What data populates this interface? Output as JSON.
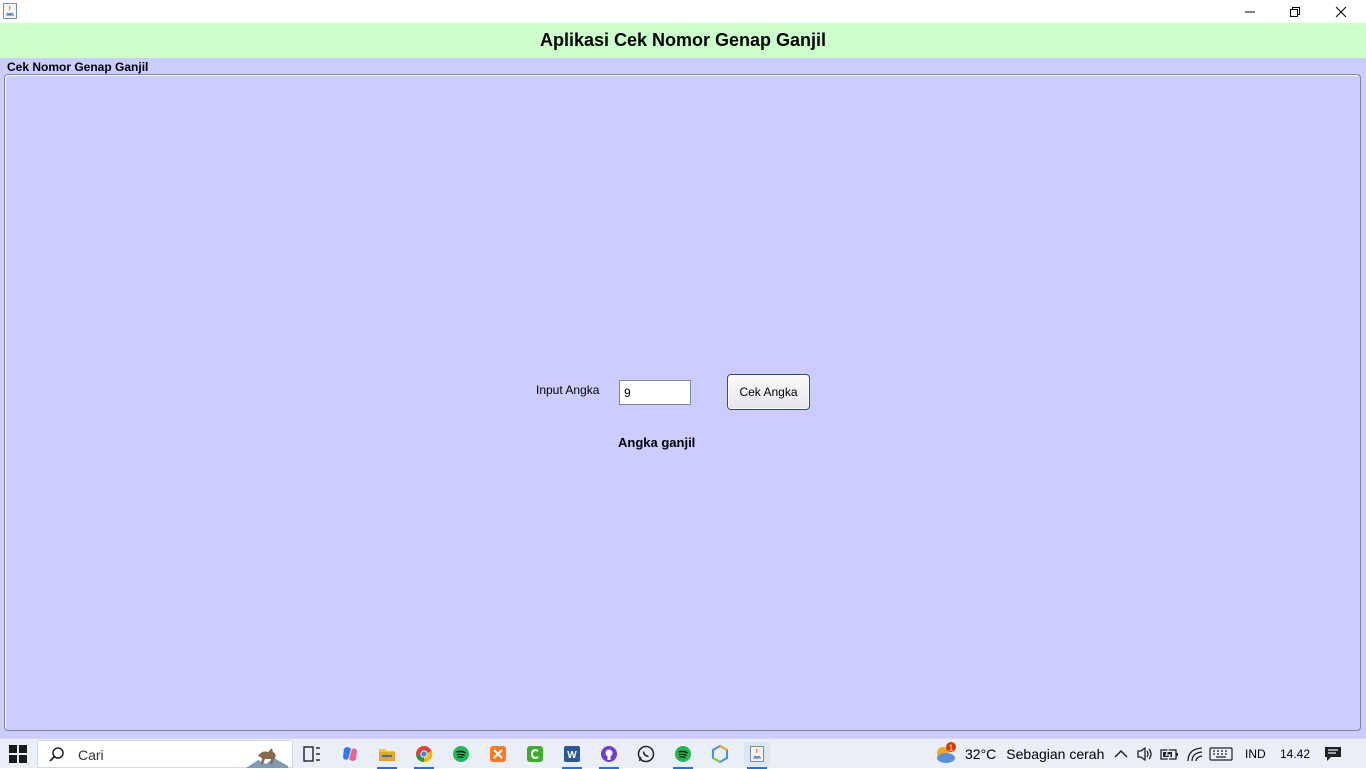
{
  "window": {
    "title": "",
    "header_title": "Aplikasi Cek Nomor Genap Ganjil"
  },
  "main": {
    "group_label": "Cek Nomor Genap Ganjil",
    "input_label": "Input Angka",
    "input_value": "9",
    "button_label": "Cek Angka",
    "result_text": "Angka ganjil"
  },
  "colors": {
    "header_bg": "#ccffcc",
    "panel_bg": "#ccccff",
    "taskbar_bg": "#eaeef6"
  },
  "taskbar": {
    "search_placeholder": "Cari",
    "apps": [
      "task-view-icon",
      "copilot-icon",
      "file-explorer-icon",
      "chrome-icon",
      "spotify-icon",
      "xampp-icon",
      "camtasia-icon",
      "word-icon",
      "github-desktop-icon",
      "whatsapp-icon",
      "spotify-icon",
      "unity-hub-icon",
      "java-app-icon"
    ],
    "weather_badge": "1",
    "weather_temp": "32°C",
    "weather_desc": "Sebagian cerah",
    "language": "IND",
    "time": "14.42"
  }
}
